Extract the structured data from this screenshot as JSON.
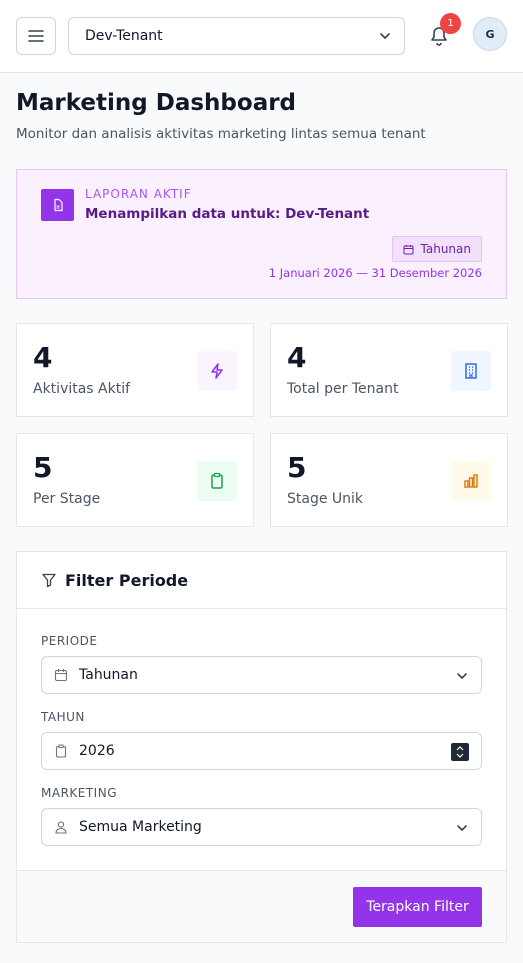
{
  "header": {
    "tenant_selected": "Dev-Tenant",
    "notification_count": "1",
    "avatar_initial": "G"
  },
  "page": {
    "title": "Marketing Dashboard",
    "subtitle": "Monitor dan analisis aktivitas marketing lintas semua tenant"
  },
  "report": {
    "kicker": "LAPORAN AKTIF",
    "title": "Menampilkan data untuk: Dev-Tenant",
    "period_chip": "Tahunan",
    "date_range": "1 Januari 2026 — 31 Desember 2026"
  },
  "stats": [
    {
      "value": "4",
      "label": "Aktivitas Aktif",
      "icon": "bolt-icon",
      "color": "#9333ea",
      "bg": "#faf5ff"
    },
    {
      "value": "4",
      "label": "Total per Tenant",
      "icon": "building-icon",
      "color": "#2563eb",
      "bg": "#eff6ff"
    },
    {
      "value": "5",
      "label": "Per Stage",
      "icon": "clipboard-icon",
      "color": "#16a34a",
      "bg": "#ecfdf3"
    },
    {
      "value": "5",
      "label": "Stage Unik",
      "icon": "bar-chart-icon",
      "color": "#d97706",
      "bg": "#fffbeb"
    }
  ],
  "filter": {
    "title": "Filter Periode",
    "periode_label": "PERIODE",
    "periode_value": "Tahunan",
    "tahun_label": "TAHUN",
    "tahun_value": "2026",
    "marketing_label": "MARKETING",
    "marketing_value": "Semua Marketing",
    "apply_label": "Terapkan Filter"
  },
  "colors": {
    "accent": "#9333ea",
    "badge": "#ef4444"
  }
}
